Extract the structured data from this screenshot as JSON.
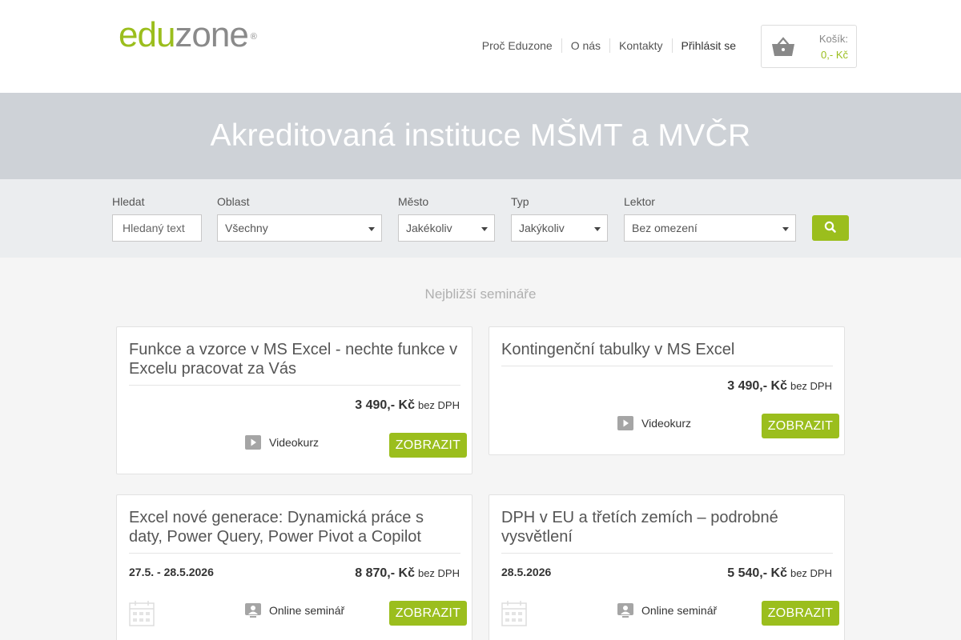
{
  "brand": {
    "logo_a": "edu",
    "logo_b": "zone",
    "logo_mark": "®",
    "accent": "#9bbe1d"
  },
  "nav": {
    "items": [
      "Proč Eduzone",
      "O nás",
      "Kontakty"
    ],
    "login": "Přihlásit se"
  },
  "cart": {
    "label": "Košík:",
    "total": "0,- Kč",
    "icon": "basket-icon"
  },
  "banner": {
    "title": "Akreditovaná instituce MŠMT a MVČR"
  },
  "filters": {
    "search": {
      "label": "Hledat",
      "placeholder": "Hledaný text"
    },
    "area": {
      "label": "Oblast",
      "value": "Všechny"
    },
    "city": {
      "label": "Město",
      "value": "Jakékoliv"
    },
    "type": {
      "label": "Typ",
      "value": "Jakýkoliv"
    },
    "lecturer": {
      "label": "Lektor",
      "value": "Bez omezení"
    },
    "search_button_icon": "search-icon"
  },
  "section": {
    "title": "Nejbližší semináře"
  },
  "courses": [
    {
      "title": "Funkce a vzorce v MS Excel - nechte funkce v Excelu pracovat za Vás",
      "date": "",
      "price": "3 490,- Kč",
      "vat": "bez DPH",
      "type": "Videokurz",
      "type_icon": "play-icon",
      "button": "ZOBRAZIT"
    },
    {
      "title": "Kontingenční tabulky v MS Excel",
      "date": "",
      "price": "3 490,- Kč",
      "vat": "bez DPH",
      "type": "Videokurz",
      "type_icon": "play-icon",
      "button": "ZOBRAZIT"
    },
    {
      "title": "Excel nové generace: Dynamická práce s daty, Power Query, Power Pivot a Copilot",
      "date": "27.5. - 28.5.2026",
      "price": "8 870,- Kč",
      "vat": "bez DPH",
      "type": "Online seminář",
      "type_icon": "online-seminar-icon",
      "button": "ZOBRAZIT"
    },
    {
      "title": "DPH v EU a třetích zemích – podrobné vysvětlení",
      "date": "28.5.2026",
      "price": "5 540,- Kč",
      "vat": "bez DPH",
      "type": "Online seminář",
      "type_icon": "online-seminar-icon",
      "button": "ZOBRAZIT"
    }
  ]
}
